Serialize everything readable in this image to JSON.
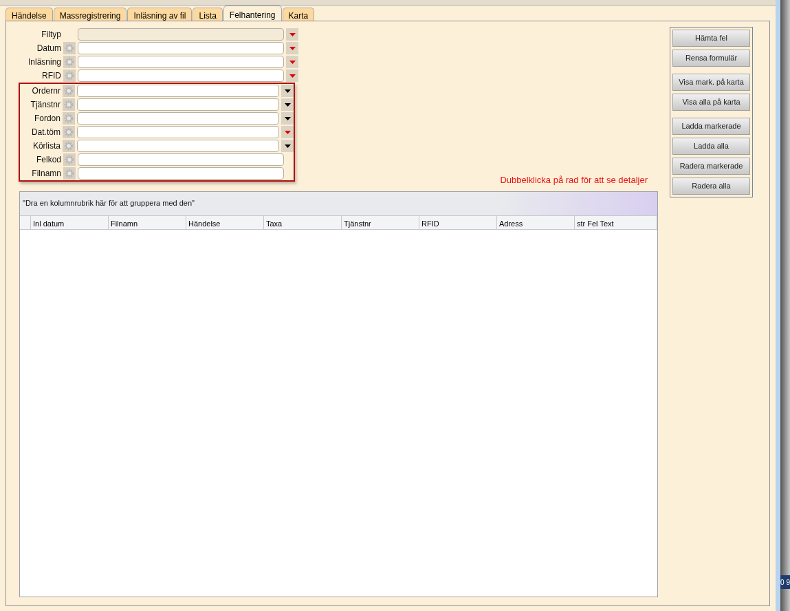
{
  "tabs": [
    {
      "label": "Händelse",
      "selected": false
    },
    {
      "label": "Massregistrering",
      "selected": false
    },
    {
      "label": "Inläsning av fil",
      "selected": false
    },
    {
      "label": "Lista",
      "selected": false
    },
    {
      "label": "Felhantering",
      "selected": true
    },
    {
      "label": "Karta",
      "selected": false
    }
  ],
  "filters": [
    {
      "label": "Filtyp",
      "gear": false,
      "disabled": true,
      "dropdown": true,
      "color": "#e00000"
    },
    {
      "label": "Datum",
      "gear": true,
      "disabled": false,
      "dropdown": true,
      "color": "#e00000"
    },
    {
      "label": "Inläsning",
      "gear": true,
      "disabled": false,
      "dropdown": true,
      "color": "#e00000"
    },
    {
      "label": "RFID",
      "gear": true,
      "disabled": false,
      "dropdown": true,
      "color": "#e00000"
    }
  ],
  "highlighted_filters": [
    {
      "label": "Ordernr",
      "gear": true,
      "disabled": false,
      "dropdown": true,
      "color": "#000000"
    },
    {
      "label": "Tjänstnr",
      "gear": true,
      "disabled": false,
      "dropdown": true,
      "color": "#000000"
    },
    {
      "label": "Fordon",
      "gear": true,
      "disabled": false,
      "dropdown": true,
      "color": "#000000"
    },
    {
      "label": "Dat.töm",
      "gear": true,
      "disabled": false,
      "dropdown": true,
      "color": "#e00000"
    },
    {
      "label": "Körlista",
      "gear": true,
      "disabled": false,
      "dropdown": true,
      "color": "#000000"
    },
    {
      "label": "Felkod",
      "gear": true,
      "disabled": false,
      "dropdown": false
    },
    {
      "label": "Filnamn",
      "gear": true,
      "disabled": false,
      "dropdown": false
    }
  ],
  "hint": "Dubbelklicka på rad för att se detaljer",
  "grid": {
    "group_panel": "\"Dra en kolumnrubrik här för att gruppera med den\"",
    "columns": [
      "Inl datum",
      "Filnamn",
      "Händelse",
      "Taxa",
      "Tjänstnr",
      "RFID",
      "Adress",
      "str Fel Text"
    ]
  },
  "button_groups": [
    [
      "Hämta fel",
      "Rensa formulär"
    ],
    [
      "Visa mark. på karta",
      "Visa alla på karta"
    ],
    [
      "Ladda markerade",
      "Ladda alla",
      "Radera markerade",
      "Radera alla"
    ]
  ],
  "side_fragment": "0 9"
}
